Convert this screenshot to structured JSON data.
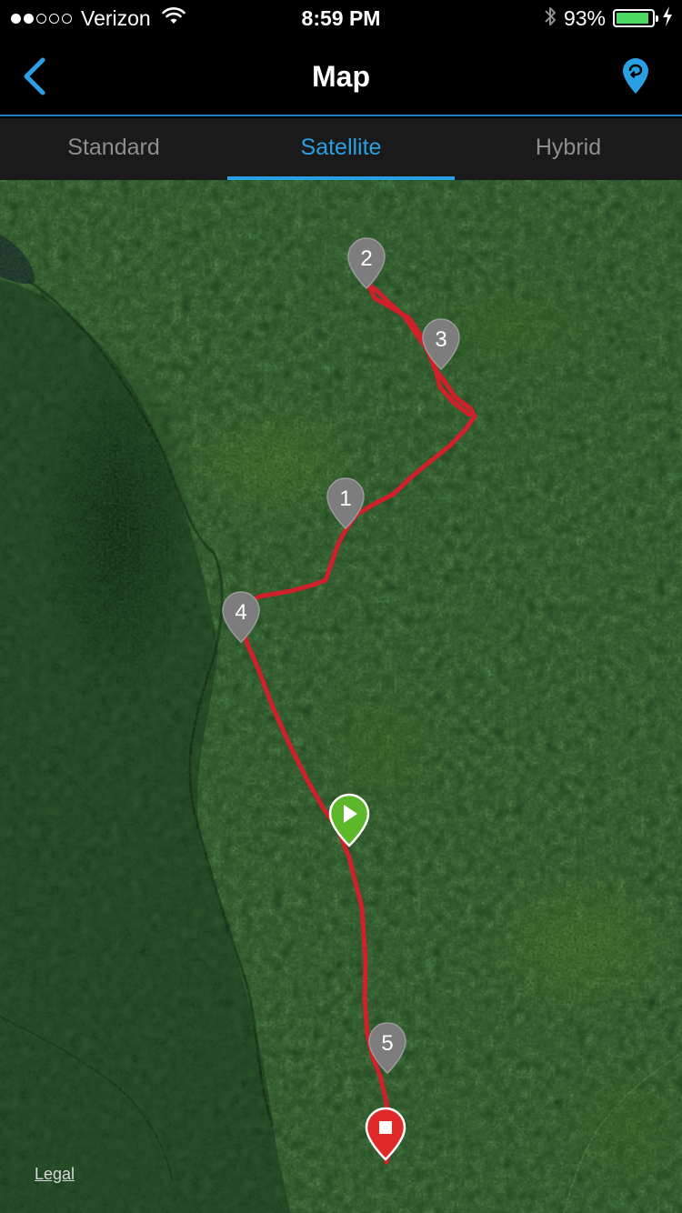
{
  "status_bar": {
    "carrier": "Verizon",
    "time": "8:59 PM",
    "battery_percent": "93%",
    "battery_level": 0.93,
    "signal_bars_filled": 2,
    "signal_bars_total": 5
  },
  "nav": {
    "title": "Map",
    "back_icon": "chevron-left-icon",
    "right_icon": "map-pin-route-icon",
    "accent_color": "#2aa0e4"
  },
  "tabs": [
    {
      "label": "Standard",
      "active": false
    },
    {
      "label": "Satellite",
      "active": true
    },
    {
      "label": "Hybrid",
      "active": false
    }
  ],
  "map": {
    "mode": "Satellite",
    "track_color": "#d0202a",
    "lap_markers": [
      {
        "label": "2"
      },
      {
        "label": "3"
      },
      {
        "label": "1"
      },
      {
        "label": "4"
      },
      {
        "label": "5"
      }
    ],
    "start_marker": "play-icon",
    "finish_marker": "stop-icon",
    "legal_label": "Legal"
  }
}
